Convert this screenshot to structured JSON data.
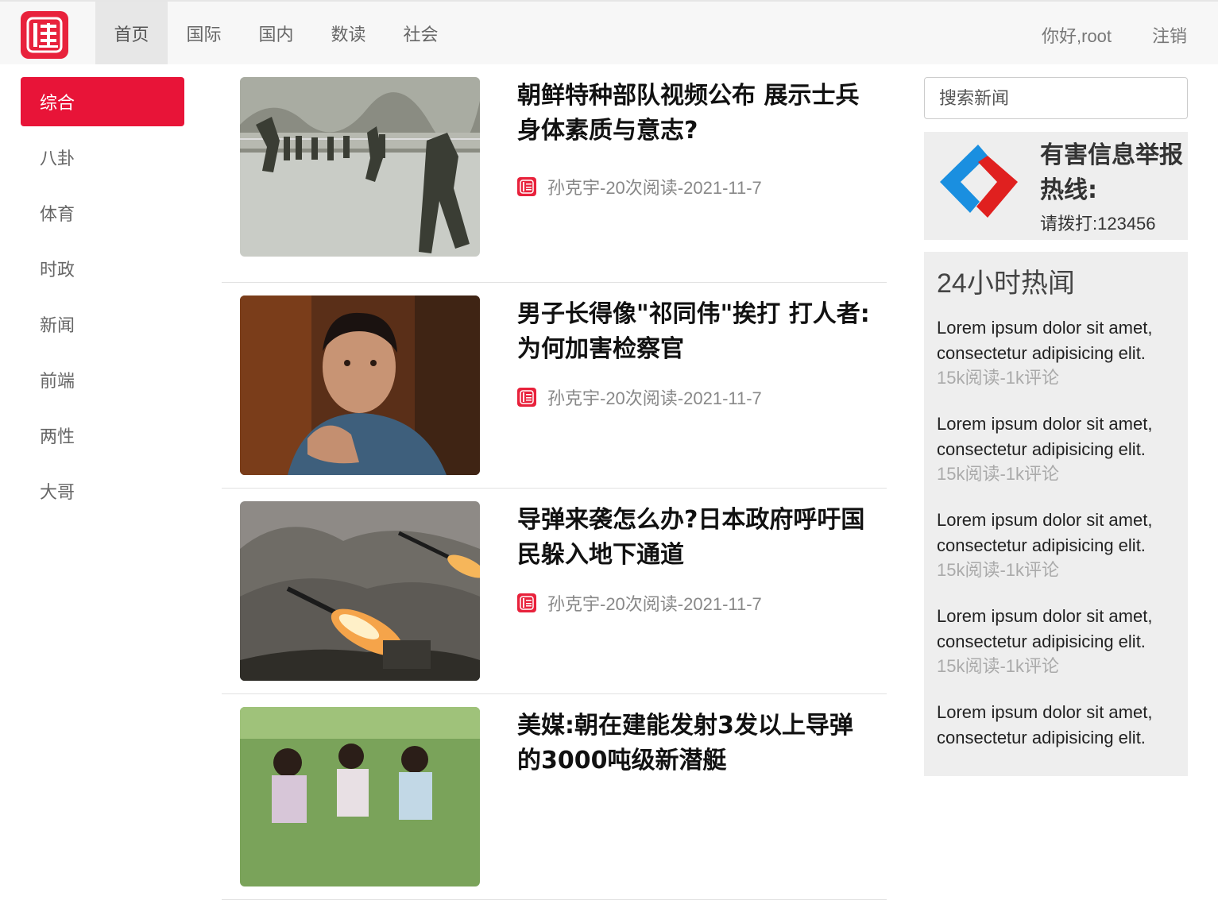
{
  "nav": {
    "logo_char": "佳",
    "items": [
      "首页",
      "国际",
      "国内",
      "数读",
      "社会"
    ],
    "greeting": "你好,root",
    "logout": "注销"
  },
  "sidebar": {
    "items": [
      "综合",
      "八卦",
      "体育",
      "时政",
      "新闻",
      "前端",
      "两性",
      "大哥"
    ]
  },
  "articles": [
    {
      "title": "朝鲜特种部队视频公布 展示士兵身体素质与意志?",
      "meta": "孙克宇-20次阅读-2021-11-7"
    },
    {
      "title": "男子长得像\"祁同伟\"挨打 打人者:为何加害检察官",
      "meta": "孙克宇-20次阅读-2021-11-7"
    },
    {
      "title": "导弹来袭怎么办?日本政府呼吁国民躲入地下通道",
      "meta": "孙克宇-20次阅读-2021-11-7"
    },
    {
      "title": "美媒:朝在建能发射3发以上导弹的3000吨级新潜艇",
      "meta": ""
    }
  ],
  "search": {
    "placeholder": "搜索新闻"
  },
  "report": {
    "title": "有害信息举报热线:",
    "phone": "请拨打:123456"
  },
  "hot": {
    "title": "24小时热闻",
    "items": [
      {
        "text": "Lorem ipsum dolor sit amet, consectetur adipisicing elit.",
        "stat": "15k阅读-1k评论"
      },
      {
        "text": "Lorem ipsum dolor sit amet, consectetur adipisicing elit.",
        "stat": "15k阅读-1k评论"
      },
      {
        "text": "Lorem ipsum dolor sit amet, consectetur adipisicing elit.",
        "stat": "15k阅读-1k评论"
      },
      {
        "text": "Lorem ipsum dolor sit amet, consectetur adipisicing elit.",
        "stat": "15k阅读-1k评论"
      },
      {
        "text": "Lorem ipsum dolor sit amet, consectetur adipisicing elit.",
        "stat": ""
      }
    ]
  },
  "colors": {
    "brand_red": "#e81438",
    "report_blue": "#1a8fe0",
    "report_red": "#e0201f"
  }
}
